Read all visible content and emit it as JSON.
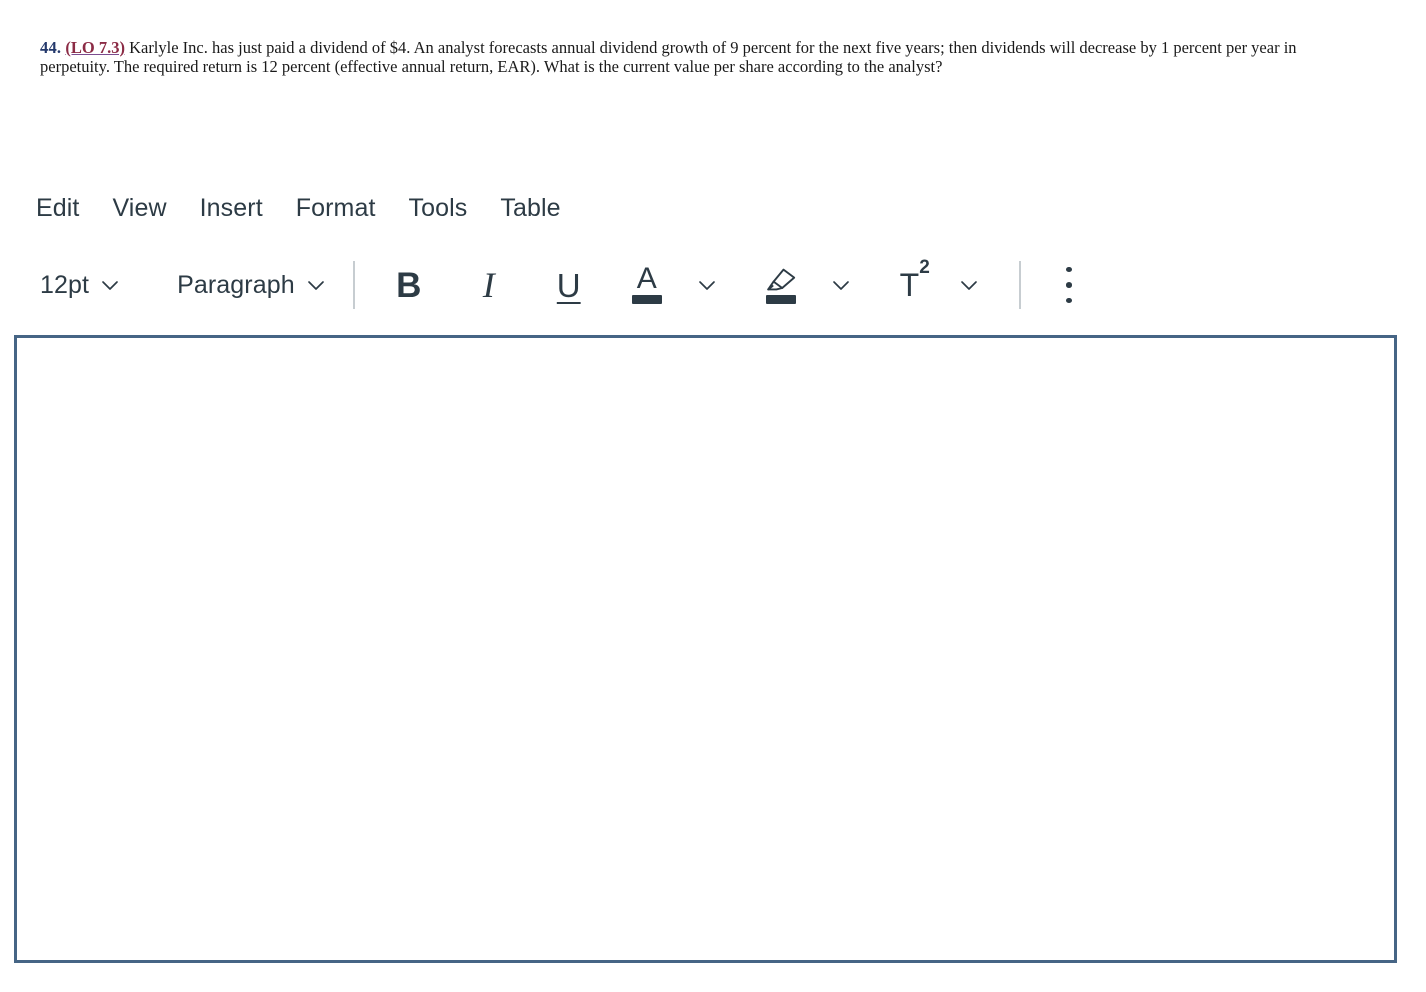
{
  "question": {
    "number": "44.",
    "lo_tag": "(LO 7.3)",
    "line1_text": " Karlyle Inc. has just paid a dividend of $4. An analyst forecasts annual dividend growth of 9 percent for the next five years; then dividends will decrease by 1 percent per year in",
    "line2_text": "perpetuity. The required return is 12 percent (effective annual return, EAR). What is the current value per share according to the analyst?"
  },
  "menu": {
    "items": [
      {
        "label": "Edit"
      },
      {
        "label": "View"
      },
      {
        "label": "Insert"
      },
      {
        "label": "Format"
      },
      {
        "label": "Tools"
      },
      {
        "label": "Table"
      }
    ]
  },
  "toolbar": {
    "font_size": "12pt",
    "block_format": "Paragraph",
    "bold_label": "B",
    "italic_label": "I",
    "underline_label": "U",
    "text_color_label": "A",
    "superscript_label": "T",
    "superscript_exponent": "2"
  },
  "editor": {
    "content": "",
    "placeholder": ""
  },
  "colors": {
    "text": "#2D3B45",
    "editor_border": "#466585",
    "divider": "#C7CDD1",
    "question_number": "#23386B",
    "lo_link": "#8B2B45",
    "swatch": "#2D3B45"
  }
}
